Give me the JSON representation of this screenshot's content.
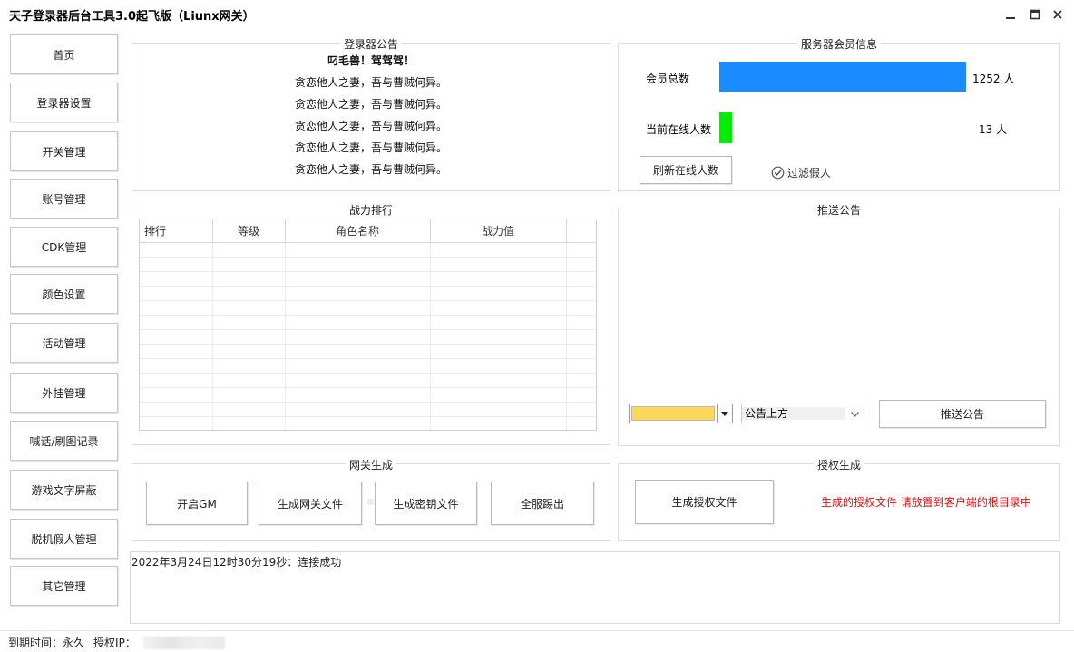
{
  "window": {
    "title": "天子登录器后台工具3.0起飞版（Liunx网关）",
    "minimize_icon": "minimize-icon",
    "maximize_icon": "maximize-icon",
    "close_icon": "close-icon"
  },
  "sidebar": {
    "items": [
      {
        "label": "首页"
      },
      {
        "label": "登录器设置"
      },
      {
        "label": "开关管理"
      },
      {
        "label": "账号管理"
      },
      {
        "label": "CDK管理"
      },
      {
        "label": "颜色设置"
      },
      {
        "label": "活动管理"
      },
      {
        "label": "外挂管理"
      },
      {
        "label": "喊话/刷图记录"
      },
      {
        "label": "游戏文字屏蔽"
      },
      {
        "label": "脱机假人管理"
      },
      {
        "label": "其它管理"
      }
    ]
  },
  "notice": {
    "title": "登录器公告",
    "lines": [
      "叼毛兽！驾驾驾！",
      "贪恋他人之妻，吾与曹贼何异。",
      "贪恋他人之妻，吾与曹贼何异。",
      "贪恋他人之妻，吾与曹贼何异。",
      "贪恋他人之妻，吾与曹贼何异。",
      "贪恋他人之妻，吾与曹贼何异。"
    ]
  },
  "members": {
    "title": "服务器会员信息",
    "total_label": "会员总数",
    "total_value": "1252 人",
    "total_count": 1252,
    "total_color": "#1a8cff",
    "online_label": "当前在线人数",
    "online_value": "13  人",
    "online_count": 13,
    "online_color": "#00ee00",
    "refresh_button": "刷新在线人数",
    "filter_label": "过滤假人",
    "filter_checked": true
  },
  "ranking": {
    "title": "战力排行",
    "columns": [
      "排行",
      "等级",
      "角色名称",
      "战力值"
    ]
  },
  "push": {
    "title": "推送公告",
    "color_value": "#ffd75a",
    "position_value": "公告上方",
    "push_button": "推送公告"
  },
  "gateway": {
    "title": "网关生成",
    "buttons": [
      "开启GM",
      "生成网关文件",
      "生成密钥文件",
      "全服踢出"
    ]
  },
  "auth": {
    "title": "授权生成",
    "button": "生成授权文件",
    "note": "生成的授权文件 请放置到客户端的根目录中"
  },
  "log": {
    "text": "2022年3月24日12时30分19秒：连接成功"
  },
  "status": {
    "expiry_label": "到期时间：",
    "expiry_value": "永久",
    "ip_label": "授权IP："
  }
}
